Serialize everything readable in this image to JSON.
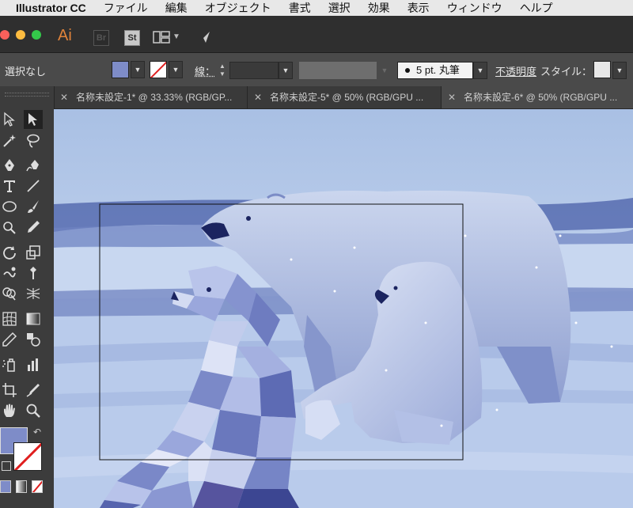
{
  "menubar": {
    "app_name": "Illustrator CC",
    "items": [
      "ファイル",
      "編集",
      "オブジェクト",
      "書式",
      "選択",
      "効果",
      "表示",
      "ウィンドウ",
      "ヘルプ"
    ]
  },
  "appbar": {
    "logo_text": "Ai",
    "bridge_label": "Br",
    "stock_label": "St"
  },
  "control": {
    "selection_label": "選択なし",
    "stroke_label": "線：",
    "brush_value": "5 pt. 丸筆",
    "opacity_label": "不透明度",
    "style_label": "スタイル："
  },
  "tabs": [
    {
      "label": "名称未設定-1* @ 33.33% (RGB/GP..."
    },
    {
      "label": "名称未設定-5* @ 50% (RGB/GPU ..."
    },
    {
      "label": "名称未設定-6* @ 50% (RGB/GPU ..."
    }
  ],
  "colors": {
    "fill": "#7e8cc8",
    "stroke_none": "#e02020",
    "ai_logo": "#e0833a",
    "canvas_tint": "#a7bde0"
  },
  "tool_icons": [
    "direct-selection-icon",
    "selection-icon",
    "magic-wand-icon",
    "lasso-icon",
    "pen-icon",
    "curvature-icon",
    "type-icon",
    "line-segment-icon",
    "ellipse-icon",
    "paintbrush-icon",
    "shaper-icon",
    "pencil-icon",
    "rotate-icon",
    "scale-icon",
    "warp-icon",
    "puppet-warp-icon",
    "shape-builder-icon",
    "perspective-grid-icon",
    "mesh-icon",
    "gradient-icon",
    "eyedropper-icon",
    "blend-icon",
    "symbol-sprayer-icon",
    "column-graph-icon",
    "artboard-icon",
    "slice-icon",
    "hand-icon",
    "zoom-icon"
  ]
}
